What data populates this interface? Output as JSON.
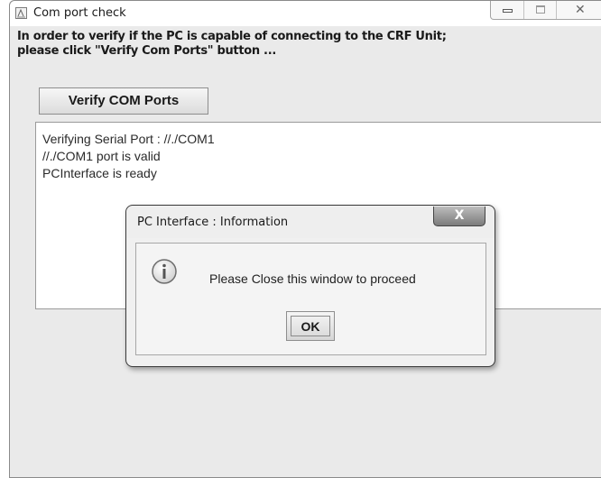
{
  "window": {
    "title": "Com port check",
    "close_glyph": "✕"
  },
  "instructions": {
    "line1": "In order to verify if the PC is capable of connecting to the CRF Unit;",
    "line2": "please click \"Verify Com Ports\" button ..."
  },
  "verify_button": {
    "label": "Verify COM Ports"
  },
  "log": {
    "lines": [
      "Verifying Serial Port : //./COM1",
      "//./COM1 port is valid",
      "PCInterface is ready"
    ]
  },
  "dialog": {
    "title": "PC Interface : Information",
    "close_glyph": "X",
    "icon": "info-icon",
    "message": "Please Close this window to proceed",
    "ok_label": "OK"
  }
}
